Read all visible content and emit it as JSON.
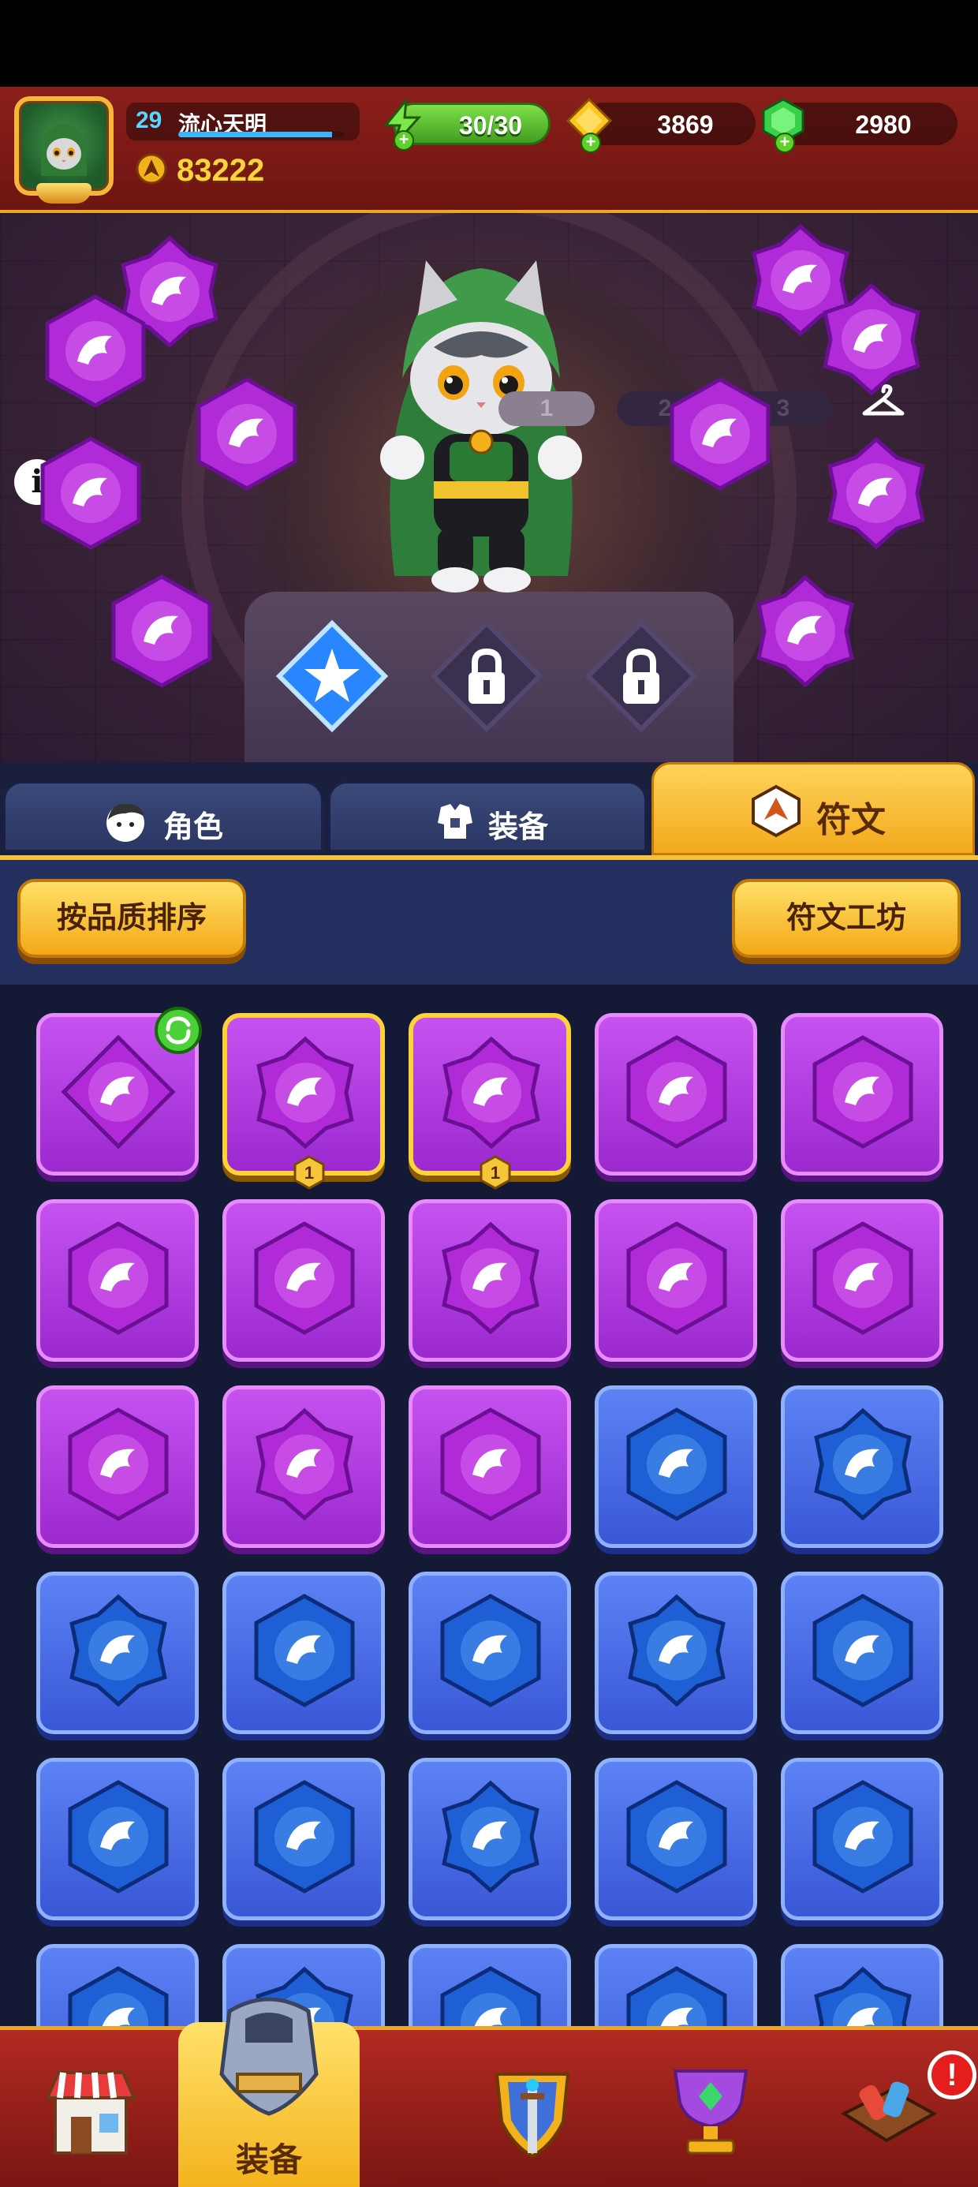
{
  "header": {
    "player_level": "29",
    "player_name": "流心天明",
    "power": "83222",
    "energy": "30/30",
    "gold": "3869",
    "gems": "2980",
    "xp_progress": 0.93,
    "icons": {
      "avatar": "cat-hero-avatar-icon",
      "power": "power-icon",
      "energy": "lightning-icon",
      "gold": "gold-coin-icon",
      "gems": "green-gem-icon",
      "add": "plus-icon"
    }
  },
  "stage": {
    "loadout_tabs": [
      "1",
      "2",
      "3"
    ],
    "active_loadout": "1",
    "info_symbol": "i",
    "icons": {
      "outfit": "hanger-icon",
      "locked_slot": "lock-icon"
    }
  },
  "tabs": {
    "character": "角色",
    "equipment": "装备",
    "runes": "符文",
    "active": "runes"
  },
  "sortbar": {
    "sort_button": "按品质排序",
    "workshop_button": "符文工坊"
  },
  "rune_grid": {
    "level_badge": "1",
    "rows": [
      [
        "purple",
        "purple",
        "purple",
        "purple",
        "purple"
      ],
      [
        "purple",
        "purple",
        "purple",
        "purple",
        "purple"
      ],
      [
        "purple",
        "purple",
        "purple",
        "blue",
        "blue"
      ],
      [
        "blue",
        "blue",
        "blue",
        "blue",
        "blue"
      ],
      [
        "blue",
        "blue",
        "blue",
        "blue",
        "blue"
      ],
      [
        "blue",
        "blue",
        "blue",
        "blue",
        "blue"
      ]
    ]
  },
  "bottom_nav": {
    "active_label": "装备",
    "alert": "!",
    "icons": [
      "shop-icon",
      "armor-icon",
      "shield-sword-icon",
      "trophy-icon",
      "workshop-icon"
    ]
  },
  "colors": {
    "header_red": "#8b1f1a",
    "gold_accent": "#f4c23a",
    "purple_rune": "#b33ee6",
    "blue_rune": "#4a6ce8",
    "energy_green": "#62c834"
  }
}
